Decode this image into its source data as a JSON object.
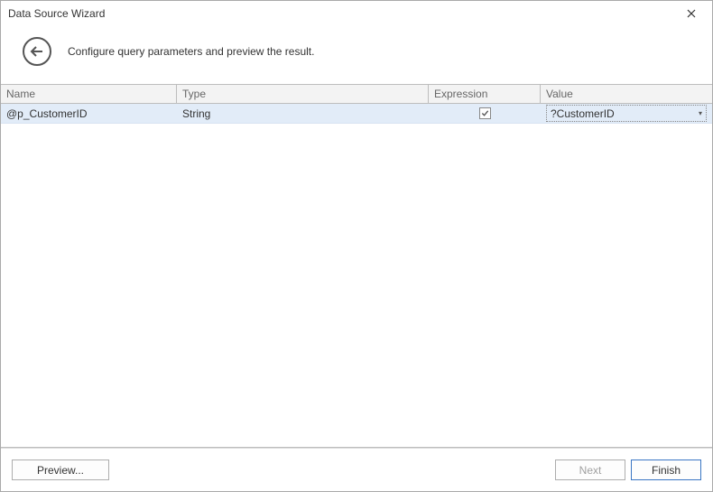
{
  "window": {
    "title": "Data Source Wizard"
  },
  "header": {
    "instruction": "Configure query parameters and preview the result."
  },
  "grid": {
    "columns": {
      "name": "Name",
      "type": "Type",
      "expression": "Expression",
      "value": "Value"
    },
    "rows": [
      {
        "name": "@p_CustomerID",
        "type": "String",
        "expression_checked": true,
        "value": "?CustomerID"
      }
    ]
  },
  "footer": {
    "preview": "Preview...",
    "next": "Next",
    "finish": "Finish"
  }
}
